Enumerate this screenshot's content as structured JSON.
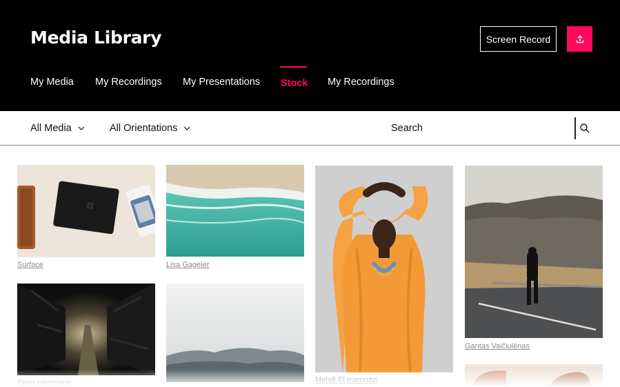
{
  "header": {
    "title": "Media Library",
    "screen_record_label": "Screen Record",
    "upload_icon": "upload-icon",
    "accent_color": "#ff0a5a"
  },
  "tabs": [
    {
      "label": "My Media",
      "active": false
    },
    {
      "label": "My Recordings",
      "active": false
    },
    {
      "label": "My Presentations",
      "active": false
    },
    {
      "label": "Stock",
      "active": true
    },
    {
      "label": "My Recordings",
      "active": false
    }
  ],
  "filters": {
    "media_filter": "All Media",
    "orientation_filter": "All Orientations",
    "search_placeholder": "Search"
  },
  "gallery": {
    "items": [
      {
        "caption": "Surface"
      },
      {
        "caption": "Lisa Gageler"
      },
      {
        "caption": "Mehdi El marouazi"
      },
      {
        "caption": "Gantas Vaičiulėnas"
      },
      {
        "caption": "Peter Herrmann"
      },
      {
        "caption": ""
      },
      {
        "caption": ""
      }
    ]
  }
}
